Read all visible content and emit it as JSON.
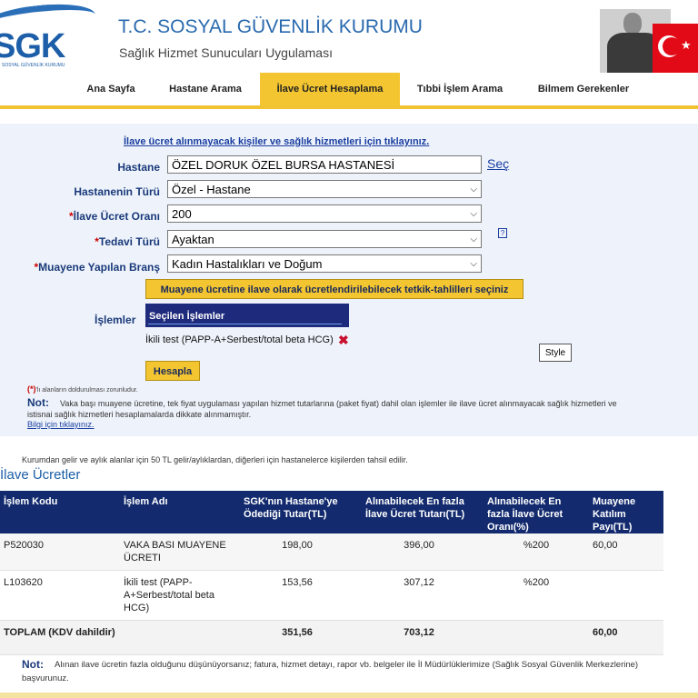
{
  "header": {
    "logo_text": "SGK",
    "logo_sub": "SOSYAL GÜVENLİK KURUMU",
    "title": "T.C. SOSYAL GÜVENLİK KURUMU",
    "subtitle": "Sağlık Hizmet Sunucuları Uygulaması"
  },
  "nav": {
    "items": [
      {
        "label": "Ana Sayfa"
      },
      {
        "label": "Hastane Arama"
      },
      {
        "label": "İlave Ücret Hesaplama"
      },
      {
        "label": "Tıbbi İşlem Arama"
      },
      {
        "label": "Bilmem Gerekenler"
      }
    ]
  },
  "form": {
    "top_link": "İlave ücret alınmayacak kişiler ve sağlık hizmetleri için tıklayınız.",
    "hastane_label": "Hastane",
    "hastane_value": "ÖZEL DORUK ÖZEL BURSA HASTANESİ",
    "sec_label": "Seç",
    "tur_label": "Hastanenin Türü",
    "tur_value": "Özel - Hastane",
    "oran_label": "İlave Ücret Oranı",
    "oran_value": "200",
    "tedavi_label": "Tedavi Türü",
    "tedavi_value": "Ayaktan",
    "brans_label": "Muayene Yapılan Branş",
    "brans_value": "Kadın Hastalıkları ve Doğum",
    "required_mark": "*",
    "help_text": "?",
    "tetkik_button": "Muayene ücretine ilave olarak ücretlendirilebilecek tetkik-tahlilleri seçiniz",
    "islemler_label": "İşlemler",
    "secilen_header": "Seçilen İşlemler",
    "secilen_item": "İkili test (PAPP-A+Serbest/total beta HCG)",
    "remove_glyph": "✖",
    "style_button": "Style",
    "hesapla_button": "Hesapla",
    "req_note_star": "(*)",
    "req_note": "'lı alanların doldurulması zorunludur.",
    "not_label": "Not:",
    "not_text": "Vaka başı muayene ücretine, tek fiyat uygulaması yapılan hizmet tutarlarına (paket fiyat) dahil olan işlemler ile ilave ücret alınmayacak sağlık hizmetleri ve",
    "not_text2": "istisnai sağlık hizmetleri hesaplamalarda dikkate alınmamıştır.",
    "bilgi_link": "Bilgi için tıklayınız."
  },
  "results": {
    "info_line": "Kurumdan gelir ve aylık alanlar için 50 TL gelir/aylıklardan, diğerleri için hastanelerce kişilerden tahsil edilir.",
    "title": "İlave Ücretler",
    "columns": [
      "İşlem Kodu",
      "İşlem Adı",
      "SGK'nın Hastane'ye Ödediği Tutar(TL)",
      "Alınabilecek En fazla İlave Ücret Tutarı(TL)",
      "Alınabilecek En fazla İlave Ücret Oranı(%)",
      "Muayene Katılım Payı(TL)"
    ],
    "rows": [
      {
        "kod": "P520030",
        "ad": "VAKA BASI MUAYENE ÜCRETI",
        "sgk": "198,00",
        "ilave": "396,00",
        "oran": "%200",
        "katilim": "60,00"
      },
      {
        "kod": "L103620",
        "ad": "İkili test (PAPP-A+Serbest/total beta HCG)",
        "sgk": "153,56",
        "ilave": "307,12",
        "oran": "%200",
        "katilim": ""
      }
    ],
    "total": {
      "label": "TOPLAM (KDV dahildir)",
      "sgk": "351,56",
      "ilave": "703,12",
      "katilim": "60,00"
    },
    "not_label": "Not:",
    "not_text": "Alınan ilave ücretin fazla olduğunu düşünüyorsanız; fatura, hizmet detayı, rapor vb. belgeler ile İl Müdürlüklerimize (Sağlık Sosyal Güvenlik Merkezlerine) başvurunuz."
  },
  "colors": {
    "accent_yellow": "#f3c531",
    "header_blue": "#2a6aaf",
    "table_header": "#132b6e",
    "form_bg": "#eef3fb"
  }
}
